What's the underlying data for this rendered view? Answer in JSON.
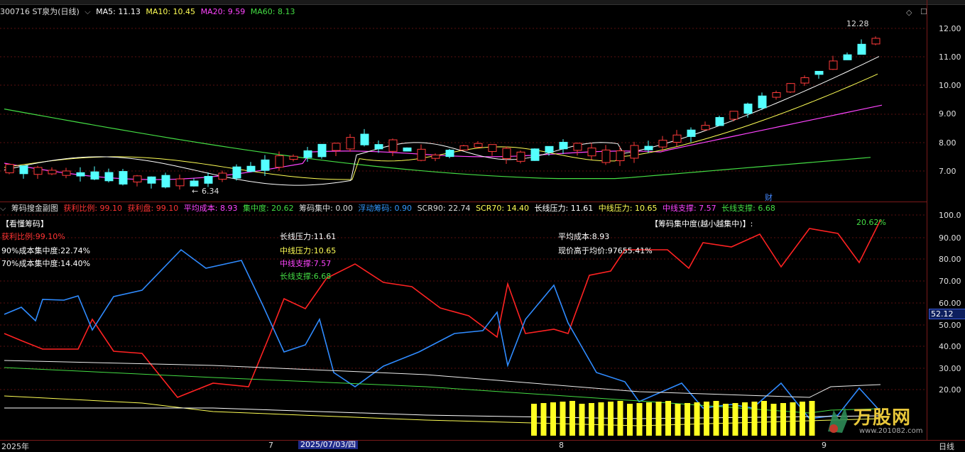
{
  "header": {
    "stock": "300716 ST泉为(日线)",
    "ma": [
      {
        "label": "MA5: 11.13",
        "color": "#ffffff"
      },
      {
        "label": "MA10: 10.45",
        "color": "#ffff55"
      },
      {
        "label": "MA20: 9.59",
        "color": "#ff44ff"
      },
      {
        "label": "MA60: 8.13",
        "color": "#44dd44"
      }
    ],
    "top_right_labels": [
      "◇",
      "☐"
    ]
  },
  "sub_header": {
    "title": "筹码搜金副图",
    "items": [
      {
        "label": "获利比例: 99.10",
        "color": "#ff3333"
      },
      {
        "label": "获利盘: 99.10",
        "color": "#ff3333"
      },
      {
        "label": "平均成本: 8.93",
        "color": "#ff44ff"
      },
      {
        "label": "集中度: 20.62",
        "color": "#44dd44"
      },
      {
        "label": "筹码集中: 0.00",
        "color": "#dddddd"
      },
      {
        "label": "浮动筹码: 0.90",
        "color": "#3399ff"
      },
      {
        "label": "SCR90: 22.74",
        "color": "#dddddd"
      },
      {
        "label": "SCR70: 14.40",
        "color": "#ffff55"
      },
      {
        "label": "长线压力: 11.61",
        "color": "#ffffff"
      },
      {
        "label": "中线压力: 10.65",
        "color": "#ffff55"
      },
      {
        "label": "中线支撑: 7.57",
        "color": "#ff44ff"
      },
      {
        "label": "长线支撑: 6.68",
        "color": "#44dd44"
      }
    ]
  },
  "main_chart": {
    "y_ticks": [
      "12.00",
      "11.00",
      "10.00",
      "9.00",
      "8.00",
      "7.00"
    ],
    "high_label": "12.28",
    "low_label": "6.34",
    "cai_label": "财"
  },
  "sub_chart": {
    "y_ticks": [
      "100.0",
      "90.00",
      "80.00",
      "70.00",
      "60.00",
      "50.00",
      "40.00",
      "30.00",
      "20.00"
    ],
    "current_value": "52.12",
    "annotations": {
      "title_left": "【看懂筹码】",
      "profit_ratio": "获利比例:99.10%",
      "scr90": "90%成本集中度:22.74%",
      "scr70": "70%成本集中度:14.40%",
      "long_pressure": "长线压力:11.61",
      "mid_pressure": "中线压力:10.65",
      "mid_support": "中线支撑:7.57",
      "long_support": "长线支撑:6.68",
      "avg_cost": "平均成本:8.93",
      "above_avg": "现价高于均价:97655.41%",
      "concentration_title": "【筹码集中度(越小越集中)】:",
      "concentration_value": "20.62%"
    }
  },
  "x_axis": {
    "labels": [
      {
        "text": "2025年"
      },
      {
        "text": "7"
      },
      {
        "text": "8"
      },
      {
        "text": "9"
      }
    ],
    "selected_date": "2025/07/03/四",
    "period": "日线"
  },
  "logo": {
    "name": "万股网",
    "url_text": "www.201082.com"
  }
}
